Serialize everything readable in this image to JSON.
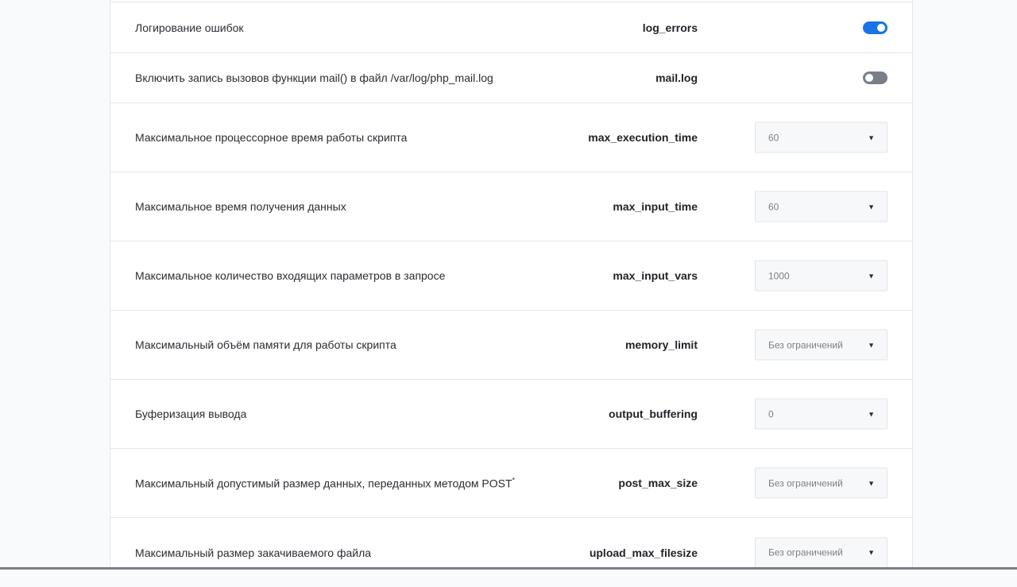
{
  "settings": [
    {
      "label": "Логирование ошибок",
      "key": "log_errors",
      "control": "toggle",
      "state": "on"
    },
    {
      "label": "Включить запись вызовов функции mail() в файл /var/log/php_mail.log",
      "key": "mail.log",
      "control": "toggle",
      "state": "off"
    },
    {
      "label": "Максимальное процессорное время работы скрипта",
      "key": "max_execution_time",
      "control": "select",
      "value": "60"
    },
    {
      "label": "Максимальное время получения данных",
      "key": "max_input_time",
      "control": "select",
      "value": "60"
    },
    {
      "label": "Максимальное количество входящих параметров в запросе",
      "key": "max_input_vars",
      "control": "select",
      "value": "1000"
    },
    {
      "label": "Максимальный объём памяти для работы скрипта",
      "key": "memory_limit",
      "control": "select",
      "value": "Без ограничений"
    },
    {
      "label": "Буферизация вывода",
      "key": "output_buffering",
      "control": "select",
      "value": "0"
    },
    {
      "label": "Максимальный допустимый размер данных, переданных методом POST",
      "label_suffix": "*",
      "key": "post_max_size",
      "control": "select",
      "value": "Без ограничений"
    },
    {
      "label": "Максимальный размер закачиваемого файла",
      "key": "upload_max_filesize",
      "control": "select",
      "value": "Без ограничений"
    }
  ],
  "icons": {
    "dropdown": "caret-down-icon"
  },
  "colors": {
    "toggle_on": "#1a73e8",
    "toggle_off": "#7a7f87",
    "page_background": "#f9fafb",
    "panel_background": "#ffffff",
    "divider": "#e3e6ea"
  }
}
